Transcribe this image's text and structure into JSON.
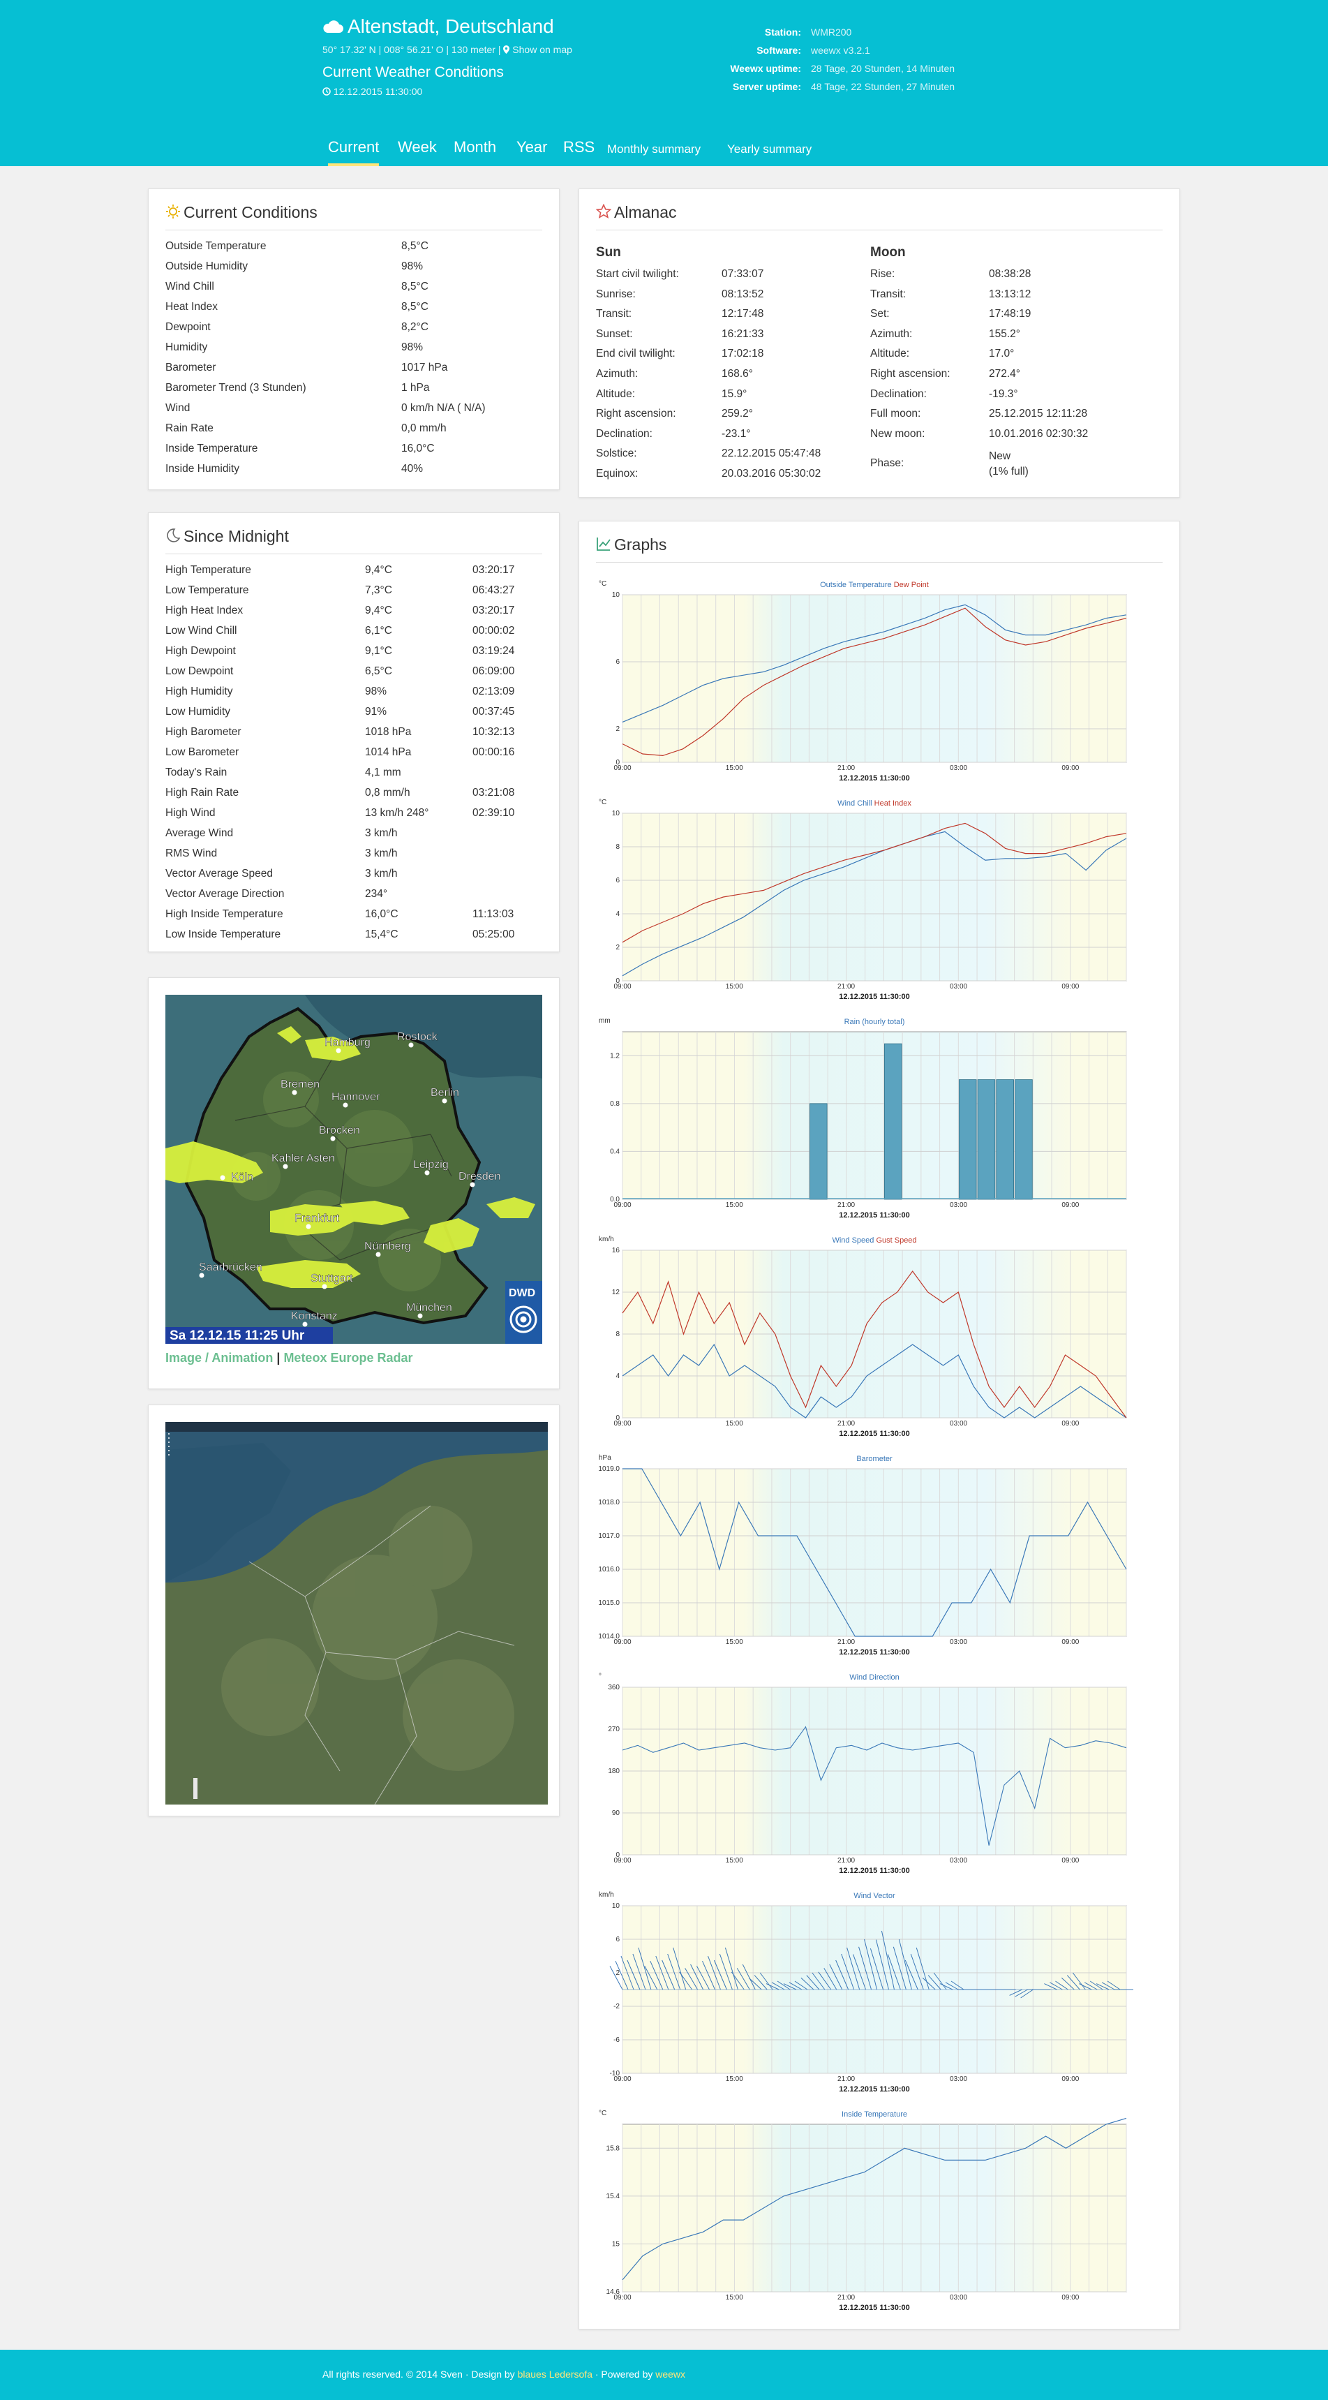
{
  "header": {
    "title": "Altenstadt, Deutschland",
    "coords": "50° 17.32' N | 008° 56.21' O | 130 meter |",
    "map_link": "Show on map",
    "subtitle": "Current Weather Conditions",
    "time": "12.12.2015 11:30:00",
    "station_info": [
      {
        "k": "Station:",
        "v": "WMR200"
      },
      {
        "k": "Software:",
        "v": "weewx v3.2.1"
      },
      {
        "k": "Weewx uptime:",
        "v": "28 Tage, 20 Stunden, 14 Minuten"
      },
      {
        "k": "Server uptime:",
        "v": "48 Tage, 22 Stunden, 27 Minuten"
      }
    ]
  },
  "nav": {
    "current": "Current",
    "week": "Week",
    "month": "Month",
    "year": "Year",
    "rss": "RSS",
    "monthly": "Monthly summary",
    "yearly": "Yearly summary"
  },
  "current": {
    "title": "Current Conditions",
    "rows": [
      [
        "Outside Temperature",
        "8,5°C"
      ],
      [
        "Outside Humidity",
        "98%"
      ],
      [
        "Wind Chill",
        "8,5°C"
      ],
      [
        "Heat Index",
        "8,5°C"
      ],
      [
        "Dewpoint",
        "8,2°C"
      ],
      [
        "Humidity",
        "98%"
      ],
      [
        "Barometer",
        "1017 hPa"
      ],
      [
        "Barometer Trend (3 Stunden)",
        "1 hPa"
      ],
      [
        "Wind",
        "0 km/h N/A ( N/A)"
      ],
      [
        "Rain Rate",
        "0,0 mm/h"
      ],
      [
        "Inside Temperature",
        "16,0°C"
      ],
      [
        "Inside Humidity",
        "40%"
      ]
    ]
  },
  "midnight": {
    "title": "Since Midnight",
    "rows": [
      [
        "High Temperature",
        "9,4°C",
        "03:20:17"
      ],
      [
        "Low Temperature",
        "7,3°C",
        "06:43:27"
      ],
      [
        "High Heat Index",
        "9,4°C",
        "03:20:17"
      ],
      [
        "Low Wind Chill",
        "6,1°C",
        "00:00:02"
      ],
      [
        "High Dewpoint",
        "9,1°C",
        "03:19:24"
      ],
      [
        "Low Dewpoint",
        "6,5°C",
        "06:09:00"
      ],
      [
        "High Humidity",
        "98%",
        "02:13:09"
      ],
      [
        "Low Humidity",
        "91%",
        "00:37:45"
      ],
      [
        "High Barometer",
        "1018 hPa",
        "10:32:13"
      ],
      [
        "Low Barometer",
        "1014 hPa",
        "00:00:16"
      ],
      [
        "Today's Rain",
        "4,1 mm",
        ""
      ],
      [
        "High Rain Rate",
        "0,8 mm/h",
        "03:21:08"
      ],
      [
        "High Wind",
        "13 km/h 248°",
        "02:39:10"
      ],
      [
        "Average Wind",
        "3 km/h",
        ""
      ],
      [
        "RMS Wind",
        "3 km/h",
        ""
      ],
      [
        "Vector Average Speed",
        "3 km/h",
        ""
      ],
      [
        "Vector Average Direction",
        "234°",
        ""
      ],
      [
        "High Inside Temperature",
        "16,0°C",
        "11:13:03"
      ],
      [
        "Low Inside Temperature",
        "15,4°C",
        "05:25:00"
      ]
    ]
  },
  "radar": {
    "cities": [
      "Hamburg",
      "Rostock",
      "Bremen",
      "Hannover",
      "Berlin",
      "Brocken",
      "Kahler Asten",
      "Leipzig",
      "Dresden",
      "Köln",
      "Frankfurt",
      "Nürnberg",
      "Saarbrücken",
      "Stuttgart",
      "München",
      "Konstanz"
    ],
    "caption": "Sa 12.12.15  11:25 Uhr",
    "logo": "DWD",
    "link1": "Image / Animation",
    "sep": "|",
    "link2": "Meteox Europe Radar"
  },
  "almanac": {
    "title": "Almanac",
    "sun_heading": "Sun",
    "moon_heading": "Moon",
    "sun": [
      [
        "Start civil twilight:",
        "07:33:07"
      ],
      [
        "Sunrise:",
        "08:13:52"
      ],
      [
        "Transit:",
        "12:17:48"
      ],
      [
        "Sunset:",
        "16:21:33"
      ],
      [
        "End civil twilight:",
        "17:02:18"
      ],
      [
        "Azimuth:",
        "168.6°"
      ],
      [
        "Altitude:",
        "15.9°"
      ],
      [
        "Right ascension:",
        "259.2°"
      ],
      [
        "Declination:",
        "-23.1°"
      ],
      [
        "Solstice:",
        "22.12.2015 05:47:48"
      ],
      [
        "Equinox:",
        "20.03.2016 05:30:02"
      ]
    ],
    "moon": [
      [
        "Rise:",
        "08:38:28"
      ],
      [
        "Transit:",
        "13:13:12"
      ],
      [
        "Set:",
        "17:48:19"
      ],
      [
        "Azimuth:",
        "155.2°"
      ],
      [
        "Altitude:",
        "17.0°"
      ],
      [
        "Right ascension:",
        "272.4°"
      ],
      [
        "Declination:",
        "-19.3°"
      ],
      [
        "Full moon:",
        "25.12.2015 12:11:28"
      ],
      [
        "New moon:",
        "10.01.2016 02:30:32"
      ]
    ],
    "phase_label": "Phase:",
    "phase_value": "New",
    "phase_detail": "(1% full)"
  },
  "graphs_title": "Graphs",
  "footer": {
    "prefix": "All rights reserved. © 2014 Sven · Design by ",
    "design": "blaues Ledersofa",
    "mid": " · Powered by ",
    "powered": "weewx"
  },
  "colors": {
    "brand": "#06bfd3",
    "accent": "#ffe57a",
    "series_blue": "#3a78b8",
    "series_red": "#c0392b",
    "bar": "#5ba3bf"
  },
  "chart_data": [
    {
      "type": "line",
      "unit": "°C",
      "title_parts": [
        [
          "Outside Temperature",
          "#3a78b8"
        ],
        [
          " Dew Point",
          "#c0392b"
        ]
      ],
      "ylim": [
        0,
        10
      ],
      "yticks": [
        0,
        2,
        6,
        10
      ],
      "xticks": [
        "09:00",
        "15:00",
        "21:00",
        "03:00",
        "09:00"
      ],
      "date": "12.12.2015 11:30:00",
      "series": [
        {
          "name": "Outside Temperature",
          "color": "#3a78b8",
          "values": [
            2.4,
            2.9,
            3.4,
            4.0,
            4.6,
            5.0,
            5.2,
            5.4,
            5.8,
            6.3,
            6.8,
            7.2,
            7.5,
            7.8,
            8.2,
            8.6,
            9.1,
            9.4,
            8.8,
            7.9,
            7.6,
            7.6,
            7.9,
            8.2,
            8.6,
            8.8
          ]
        },
        {
          "name": "Dew Point",
          "color": "#c0392b",
          "values": [
            1.1,
            0.5,
            0.4,
            0.8,
            1.6,
            2.6,
            3.8,
            4.6,
            5.2,
            5.8,
            6.3,
            6.8,
            7.1,
            7.4,
            7.8,
            8.2,
            8.7,
            9.2,
            8.1,
            7.3,
            7.0,
            7.2,
            7.6,
            8.0,
            8.3,
            8.6
          ]
        }
      ]
    },
    {
      "type": "line",
      "unit": "°C",
      "title_parts": [
        [
          "Wind Chill",
          "#3a78b8"
        ],
        [
          "  Heat Index",
          "#c0392b"
        ]
      ],
      "ylim": [
        0,
        10
      ],
      "yticks": [
        0,
        2,
        4,
        6,
        8,
        10
      ],
      "xticks": [
        "09:00",
        "15:00",
        "21:00",
        "03:00",
        "09:00"
      ],
      "date": "12.12.2015 11:30:00",
      "series": [
        {
          "name": "Wind Chill",
          "color": "#3a78b8",
          "values": [
            0.3,
            1.0,
            1.6,
            2.1,
            2.6,
            3.2,
            3.8,
            4.6,
            5.4,
            6.0,
            6.4,
            6.8,
            7.3,
            7.8,
            8.2,
            8.6,
            8.9,
            8.0,
            7.2,
            7.3,
            7.3,
            7.4,
            7.6,
            6.6,
            7.8,
            8.5
          ]
        },
        {
          "name": "Heat Index",
          "color": "#c0392b",
          "values": [
            2.3,
            3.0,
            3.5,
            4.0,
            4.6,
            5.0,
            5.2,
            5.4,
            5.9,
            6.4,
            6.8,
            7.2,
            7.5,
            7.8,
            8.2,
            8.6,
            9.1,
            9.4,
            8.8,
            7.9,
            7.6,
            7.6,
            7.9,
            8.2,
            8.6,
            8.8
          ]
        }
      ]
    },
    {
      "type": "bar",
      "unit": "mm",
      "title_parts": [
        [
          "Rain (hourly total)",
          "#3a78b8"
        ]
      ],
      "ylim": [
        0,
        1.4
      ],
      "yticks": [
        0.0,
        0.4,
        0.8,
        1.2
      ],
      "xticks": [
        "09:00",
        "15:00",
        "21:00",
        "03:00",
        "09:00"
      ],
      "date": "12.12.2015 11:30:00",
      "series": [
        {
          "name": "Rain (hourly total)",
          "color": "#5ba3bf",
          "values": [
            0,
            0,
            0,
            0,
            0,
            0,
            0,
            0,
            0,
            0,
            0.8,
            0,
            0,
            0,
            1.3,
            0,
            0,
            0,
            1.0,
            1.0,
            1.0,
            1.0,
            0,
            0,
            0,
            0,
            0
          ]
        }
      ]
    },
    {
      "type": "line",
      "unit": "km/h",
      "title_parts": [
        [
          "Wind Speed",
          "#3a78b8"
        ],
        [
          " Gust Speed",
          "#c0392b"
        ]
      ],
      "ylim": [
        0,
        16
      ],
      "yticks": [
        0,
        4,
        8,
        12,
        16
      ],
      "xticks": [
        "09:00",
        "15:00",
        "21:00",
        "03:00",
        "09:00"
      ],
      "date": "12.12.2015 11:30:00",
      "series": [
        {
          "name": "Wind Speed",
          "color": "#3a78b8",
          "values": [
            4,
            5,
            6,
            4,
            6,
            5,
            7,
            4,
            5,
            4,
            3,
            1,
            0,
            2,
            1,
            2,
            4,
            5,
            6,
            7,
            6,
            5,
            6,
            3,
            1,
            0,
            1,
            0,
            1,
            2,
            3,
            2,
            1,
            0
          ]
        },
        {
          "name": "Gust Speed",
          "color": "#c0392b",
          "values": [
            10,
            12,
            9,
            13,
            8,
            12,
            9,
            11,
            7,
            10,
            8,
            4,
            1,
            5,
            3,
            5,
            9,
            11,
            12,
            14,
            12,
            11,
            12,
            7,
            3,
            1,
            3,
            1,
            3,
            6,
            5,
            4,
            2,
            0
          ]
        }
      ]
    },
    {
      "type": "line",
      "unit": "hPa",
      "title_parts": [
        [
          "Barometer",
          "#3a78b8"
        ]
      ],
      "ylim": [
        1014,
        1019
      ],
      "yticks": [
        1014.0,
        1015.0,
        1016.0,
        1017.0,
        1018.0,
        1019.0
      ],
      "xticks": [
        "09:00",
        "15:00",
        "21:00",
        "03:00",
        "09:00"
      ],
      "date": "12.12.2015 11:30:00",
      "series": [
        {
          "name": "Barometer",
          "color": "#3a78b8",
          "values": [
            1019,
            1019,
            1018,
            1017,
            1018,
            1016,
            1018,
            1017,
            1017,
            1017,
            1016,
            1015,
            1014,
            1014,
            1014,
            1014,
            1014,
            1015,
            1015,
            1016,
            1015,
            1017,
            1017,
            1017,
            1018,
            1017,
            1016
          ]
        }
      ]
    },
    {
      "type": "scatter",
      "unit": "°",
      "title_parts": [
        [
          "Wind Direction",
          "#3a78b8"
        ]
      ],
      "ylim": [
        0,
        360
      ],
      "yticks": [
        0,
        90,
        180,
        270,
        360
      ],
      "xticks": [
        "09:00",
        "15:00",
        "21:00",
        "03:00",
        "09:00"
      ],
      "date": "12.12.2015 11:30:00",
      "series": [
        {
          "name": "Wind Direction",
          "color": "#3a78b8",
          "values": [
            225,
            235,
            220,
            230,
            240,
            225,
            230,
            235,
            240,
            230,
            225,
            230,
            275,
            160,
            230,
            235,
            225,
            240,
            230,
            225,
            230,
            235,
            240,
            220,
            20,
            150,
            180,
            100,
            250,
            230,
            235,
            245,
            240,
            230
          ]
        }
      ]
    },
    {
      "type": "line",
      "unit": "km/h",
      "title_parts": [
        [
          "Wind Vector",
          "#3a78b8"
        ]
      ],
      "ylim": [
        -10,
        10
      ],
      "yticks": [
        -10,
        -6,
        -2,
        2,
        6,
        10
      ],
      "xticks": [
        "09:00",
        "15:00",
        "21:00",
        "03:00",
        "09:00"
      ],
      "date": "12.12.2015 11:30:00",
      "series": [
        {
          "name": "Wind Vector",
          "color": "#3a78b8",
          "values": [
            4,
            5,
            4,
            5,
            3,
            4,
            5,
            3,
            2,
            1,
            1,
            2,
            3,
            5,
            6,
            7,
            6,
            5,
            2,
            1,
            0,
            0,
            0,
            -1,
            0,
            1,
            2,
            1,
            1,
            0
          ]
        }
      ]
    },
    {
      "type": "line",
      "unit": "°C",
      "title_parts": [
        [
          "Inside Temperature",
          "#3a78b8"
        ]
      ],
      "ylim": [
        14.6,
        16.0
      ],
      "yticks": [
        14.6,
        15.0,
        15.4,
        15.8
      ],
      "xticks": [
        "09:00",
        "15:00",
        "21:00",
        "03:00",
        "09:00"
      ],
      "date": "12.12.2015 11:30:00",
      "series": [
        {
          "name": "Inside Temperature",
          "color": "#3a78b8",
          "values": [
            14.7,
            14.9,
            15.0,
            15.05,
            15.1,
            15.2,
            15.2,
            15.3,
            15.4,
            15.45,
            15.5,
            15.55,
            15.6,
            15.7,
            15.8,
            15.75,
            15.7,
            15.7,
            15.7,
            15.75,
            15.8,
            15.9,
            15.8,
            15.9,
            16.0,
            16.05
          ]
        }
      ]
    }
  ]
}
